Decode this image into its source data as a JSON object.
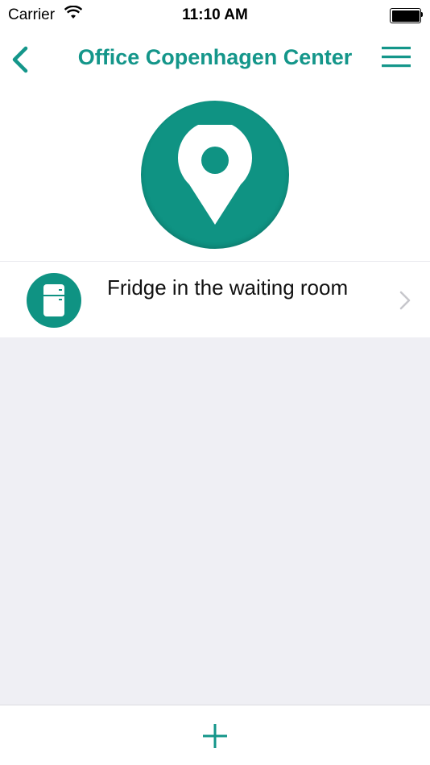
{
  "status_bar": {
    "carrier": "Carrier",
    "time": "11:10 AM",
    "battery_level": 1.0
  },
  "nav": {
    "title": "Office Copenhagen Center",
    "back_icon": "chevron-left-icon",
    "menu_icon": "hamburger-menu-icon"
  },
  "hero": {
    "icon": "location-pin-icon"
  },
  "devices": [
    {
      "label": "Fridge in the waiting room",
      "icon": "fridge-icon"
    }
  ],
  "bottom_bar": {
    "add_icon": "plus-icon"
  },
  "colors": {
    "accent": "#14968a",
    "circle": "#0f9383",
    "background": "#efeff4"
  }
}
